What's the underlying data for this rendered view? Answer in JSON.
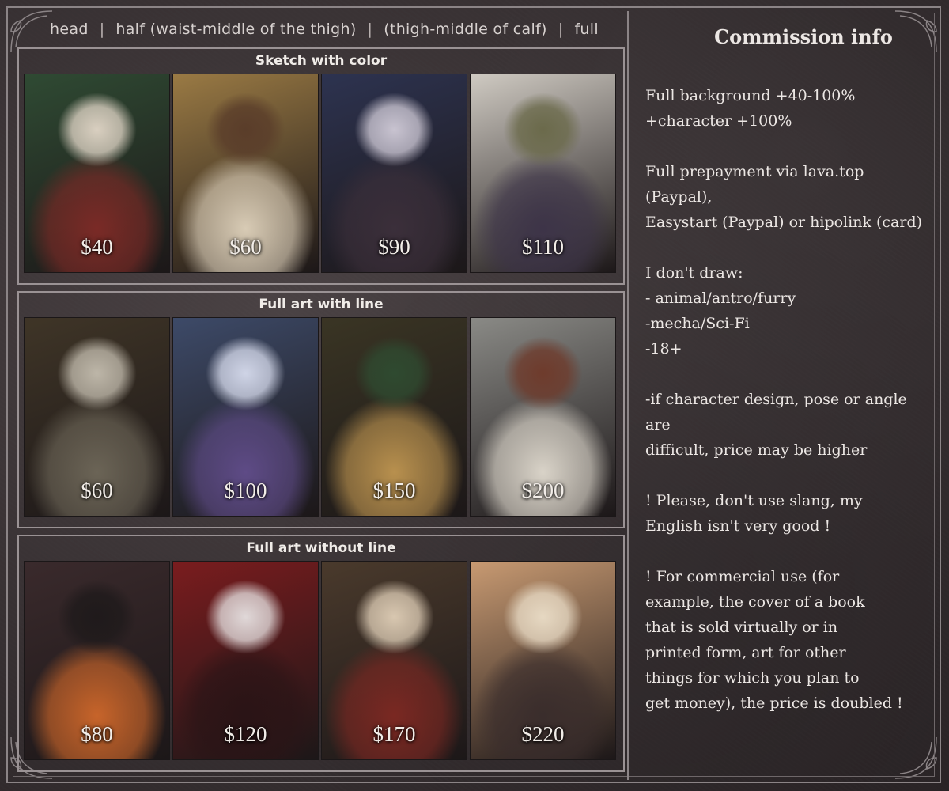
{
  "header": {
    "sizes": [
      "head",
      "half (waist-middle of the thigh)",
      "(thigh-middle of calf)",
      "full"
    ]
  },
  "sections": [
    {
      "title": "Sketch with color",
      "cards": [
        {
          "price": "$40",
          "palette": [
            "#2f4a33",
            "#7a2a26",
            "#d9cfc0"
          ]
        },
        {
          "price": "$60",
          "palette": [
            "#9a7a44",
            "#d8cbb5",
            "#5a3d2a"
          ]
        },
        {
          "price": "$90",
          "palette": [
            "#2d3350",
            "#3b2f3a",
            "#c8c3d0"
          ]
        },
        {
          "price": "$110",
          "palette": [
            "#cfcac2",
            "#3d3448",
            "#6b6a4b"
          ]
        }
      ]
    },
    {
      "title": "Full art with line",
      "cards": [
        {
          "price": "$60",
          "palette": [
            "#3f3527",
            "#6b6456",
            "#bdb6a8"
          ]
        },
        {
          "price": "$100",
          "palette": [
            "#3d4a68",
            "#5e4b86",
            "#cfd4e6"
          ]
        },
        {
          "price": "$150",
          "palette": [
            "#3a3524",
            "#b8904e",
            "#2f4a30"
          ]
        },
        {
          "price": "$200",
          "palette": [
            "#8a8a86",
            "#d9d3c8",
            "#6e3b2c"
          ]
        }
      ]
    },
    {
      "title": "Full art without line",
      "cards": [
        {
          "price": "$80",
          "palette": [
            "#3a2a2c",
            "#c7642a",
            "#1f1a1b"
          ]
        },
        {
          "price": "$120",
          "palette": [
            "#7a1c1e",
            "#2a1416",
            "#e0d8d8"
          ]
        },
        {
          "price": "$170",
          "palette": [
            "#4a3a2c",
            "#7a2822",
            "#d8c7b0"
          ]
        },
        {
          "price": "$220",
          "palette": [
            "#c89a72",
            "#3a2d2c",
            "#e6d8c2"
          ]
        }
      ]
    }
  ],
  "info": {
    "title": "Commission info",
    "lines": [
      "Full background +40-100%",
      "+character +100%",
      "",
      "Full prepayment via lava.top (Paypal),",
      "Easystart (Paypal) or hipolink (card)",
      "",
      "I don't draw:",
      "- animal/antro/furry",
      "-mecha/Sci-Fi",
      "-18+",
      "",
      "-if character design, pose or angle are",
      "difficult, price may be higher",
      "",
      "! Please, don't use slang, my",
      "English isn't very good !",
      "",
      "! For commercial use (for",
      "example, the cover of a book",
      "that is sold virtually or in",
      "printed form, art for other",
      "things for which you plan to",
      "get money), the price is doubled !"
    ]
  }
}
